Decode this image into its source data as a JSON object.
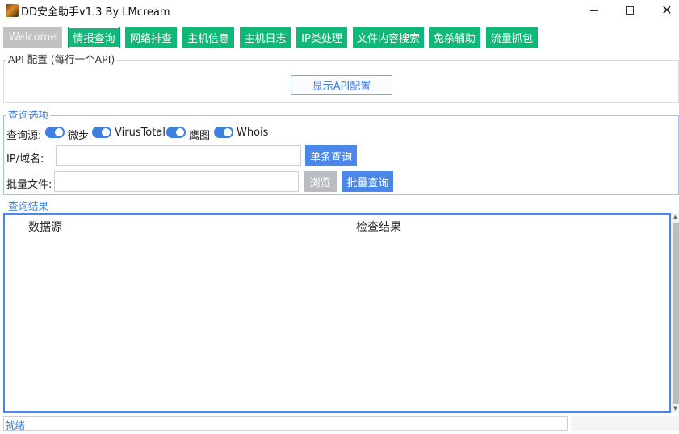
{
  "window": {
    "title": "DD安全助手v1.3 By LMcream",
    "icon": "app-icon"
  },
  "tabs": [
    {
      "label": "Welcome",
      "state": "disabled"
    },
    {
      "label": "情报查询",
      "state": "active"
    },
    {
      "label": "网络排查",
      "state": "normal"
    },
    {
      "label": "主机信息",
      "state": "normal"
    },
    {
      "label": "主机日志",
      "state": "normal"
    },
    {
      "label": "IP类处理",
      "state": "normal"
    },
    {
      "label": "文件内容搜索",
      "state": "normal"
    },
    {
      "label": "免杀辅助",
      "state": "normal"
    },
    {
      "label": "流量抓包",
      "state": "normal"
    }
  ],
  "api_config": {
    "title": "API 配置 (每行一个API)",
    "show_button": "显示API配置"
  },
  "query_options": {
    "title": "查询选项",
    "source_label": "查询源:",
    "sources": [
      {
        "label": "微步",
        "enabled": true
      },
      {
        "label": "VirusTotal",
        "enabled": true
      },
      {
        "label": "鹰图",
        "enabled": true
      },
      {
        "label": "Whois",
        "enabled": true
      }
    ],
    "ip_label": "IP/域名:",
    "ip_value": "",
    "single_query_button": "单条查询",
    "file_label": "批量文件:",
    "file_value": "",
    "browse_button": "浏览",
    "batch_query_button": "批量查询"
  },
  "results": {
    "title": "查询结果",
    "columns": [
      "数据源",
      "检查结果"
    ],
    "rows": []
  },
  "status": {
    "text": "就绪"
  },
  "colors": {
    "tab_green": "#10b776",
    "accent_blue": "#4a87e8",
    "disabled_gray": "#c2c2c2"
  }
}
